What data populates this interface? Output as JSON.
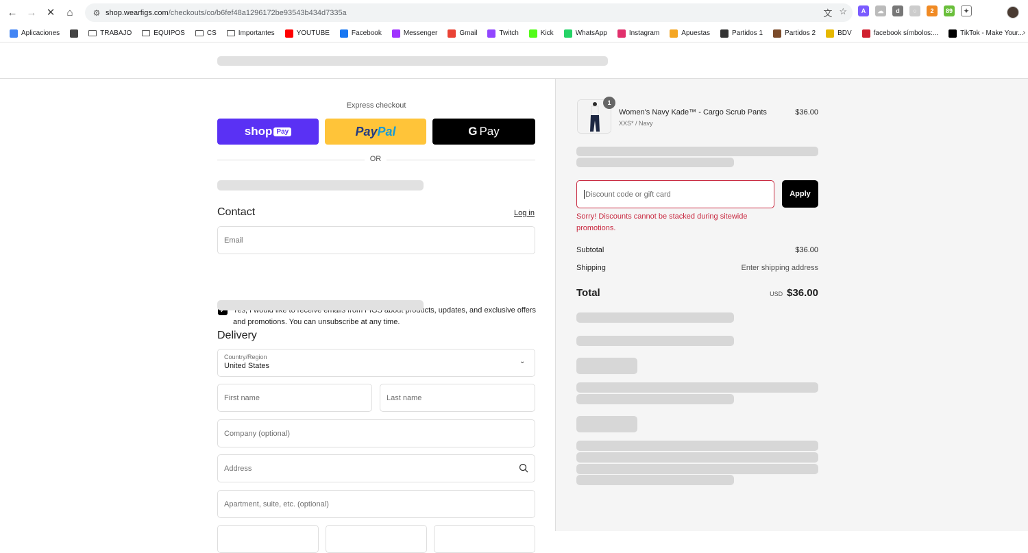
{
  "browser": {
    "url_host": "shop.wearfigs.com",
    "url_path": "/checkouts/co/b6fef48a1296172be93543b434d7335a",
    "bookmarks": [
      {
        "label": "Aplicaciones",
        "icon": "apps-grid-icon",
        "color": "#4285f4"
      },
      {
        "label": "",
        "icon": "grid-icon",
        "color": "#444"
      },
      {
        "label": "TRABAJO",
        "icon": "folder-icon",
        "color": "#555"
      },
      {
        "label": "EQUIPOS",
        "icon": "folder-icon",
        "color": "#555"
      },
      {
        "label": "CS",
        "icon": "folder-icon",
        "color": "#555"
      },
      {
        "label": "Importantes",
        "icon": "folder-icon",
        "color": "#555"
      },
      {
        "label": "YOUTUBE",
        "icon": "youtube-icon",
        "color": "#ff0000"
      },
      {
        "label": "Facebook",
        "icon": "facebook-icon",
        "color": "#1877f2"
      },
      {
        "label": "Messenger",
        "icon": "messenger-icon",
        "color": "#a033ff"
      },
      {
        "label": "Gmail",
        "icon": "gmail-icon",
        "color": "#ea4335"
      },
      {
        "label": "Twitch",
        "icon": "twitch-icon",
        "color": "#9146ff"
      },
      {
        "label": "Kick",
        "icon": "kick-icon",
        "color": "#53fc18"
      },
      {
        "label": "WhatsApp",
        "icon": "whatsapp-icon",
        "color": "#25d366"
      },
      {
        "label": "Instagram",
        "icon": "instagram-icon",
        "color": "#e1306c"
      },
      {
        "label": "Apuestas",
        "icon": "apuestas-icon",
        "color": "#f5a623"
      },
      {
        "label": "Partidos 1",
        "icon": "ball-icon",
        "color": "#333"
      },
      {
        "label": "Partidos 2",
        "icon": "partidos-icon",
        "color": "#7b4b2a"
      },
      {
        "label": "BDV",
        "icon": "bdv-icon",
        "color": "#e6b800"
      },
      {
        "label": "facebook símbolos:...",
        "icon": "symbols-icon",
        "color": "#d01f2e"
      },
      {
        "label": "TikTok - Make Your...",
        "icon": "tiktok-icon",
        "color": "#000"
      }
    ]
  },
  "express": {
    "title": "Express checkout",
    "shop_pay": "shop",
    "shop_pay_badge": "Pay",
    "paypal_a": "Pay",
    "paypal_b": "Pal",
    "gpay": "Pay",
    "or": "OR"
  },
  "contact": {
    "title": "Contact",
    "login": "Log in",
    "email_placeholder": "Email",
    "consent": "Yes, I would like to receive emails from FIGS about products, updates, and exclusive offers and promotions. You can unsubscribe at any time."
  },
  "delivery": {
    "title": "Delivery",
    "country_label": "Country/Region",
    "country_value": "United States",
    "first_name": "First name",
    "last_name": "Last name",
    "company": "Company (optional)",
    "address": "Address",
    "apartment": "Apartment, suite, etc. (optional)"
  },
  "summary": {
    "qty": "1",
    "product_name": "Women's Navy Kade™ - Cargo Scrub Pants",
    "product_variant": "XXS* / Navy",
    "product_price": "$36.00",
    "discount_placeholder": "Discount code or gift card",
    "apply": "Apply",
    "error": "Sorry! Discounts cannot be stacked during sitewide promotions.",
    "subtotal_label": "Subtotal",
    "subtotal_value": "$36.00",
    "shipping_label": "Shipping",
    "shipping_value": "Enter shipping address",
    "total_label": "Total",
    "total_currency": "USD",
    "total_value": "$36.00"
  },
  "colors": {
    "shop_pay": "#5a31f4",
    "paypal": "#ffc439",
    "error": "#c8283f"
  }
}
